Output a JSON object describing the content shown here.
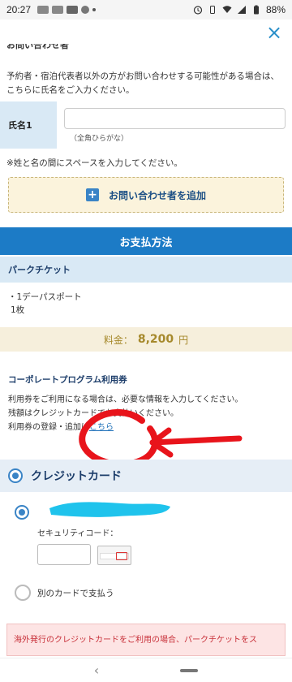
{
  "status_bar": {
    "time": "20:27",
    "battery": "88%"
  },
  "close_label": "×",
  "cut_heading": "お問い合わせ者",
  "inquiry_desc": "予約者・宿泊代表者以外の方がお問い合わせする可能性がある場合は、こちらに氏名をご入力ください。",
  "name_field": {
    "label": "氏名1",
    "value": "",
    "hint": "（全角ひらがな）"
  },
  "space_note": "※姓と名の間にスペースを入力してください。",
  "add_inquirer_button": "お問い合わせ者を追加",
  "payment": {
    "header": "お支払方法",
    "park_ticket_label": "パークチケット",
    "ticket_line1": "・1デーパスポート",
    "ticket_line2": "1枚",
    "price_label": "料金：",
    "price_value": "8,200",
    "price_unit": "円"
  },
  "corporate": {
    "title": "コーポレートプログラム利用券",
    "line1": "利用券をご利用になる場合は、必要な情報を入力してください。",
    "line2": "残額はクレジットカードでお支払いください。",
    "line3_prefix": "利用券の登録・追加は",
    "line3_link": "こちら"
  },
  "credit_card": {
    "label": "クレジットカード",
    "security_label": "セキュリティコード：",
    "security_value": "",
    "other_card_label": "別のカードで支払う"
  },
  "warning": "海外発行のクレジットカードをご利用の場合、パークチケットをス",
  "colors": {
    "primary_blue": "#1c7bc6",
    "light_blue": "#d9e9f5",
    "gold": "#a6892c",
    "warn_red": "#c8313a",
    "annotation_red": "#e8141b",
    "redaction_cyan": "#1fc3ec"
  }
}
